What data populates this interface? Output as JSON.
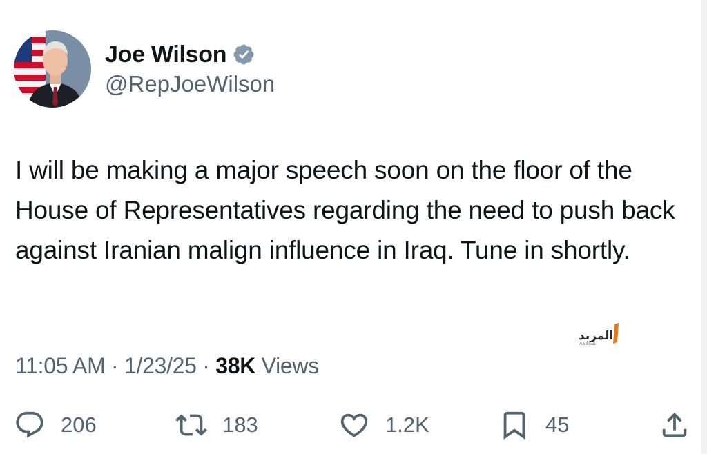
{
  "author": {
    "display_name": "Joe Wilson",
    "handle": "@RepJoeWilson",
    "verified": true
  },
  "tweet": {
    "text": "I will be making a major speech soon on the floor of the House of Representatives regarding the need to push back against Iranian malign influence in Iraq. Tune in shortly.",
    "time": "11:05 AM",
    "date": "1/23/25",
    "views_count": "38K",
    "views_label": "Views"
  },
  "watermark": {
    "text": "المربد",
    "subtext": "ALMIRBAD"
  },
  "actions": {
    "replies": "206",
    "reposts": "183",
    "likes": "1.2K",
    "bookmarks": "45"
  },
  "colors": {
    "text": "#0f1419",
    "secondary": "#536471",
    "verified_badge": "#829aab",
    "watermark": "#e07a1f"
  },
  "icons": [
    "verified-badge-icon",
    "reply-icon",
    "repost-icon",
    "like-icon",
    "bookmark-icon",
    "share-icon"
  ]
}
